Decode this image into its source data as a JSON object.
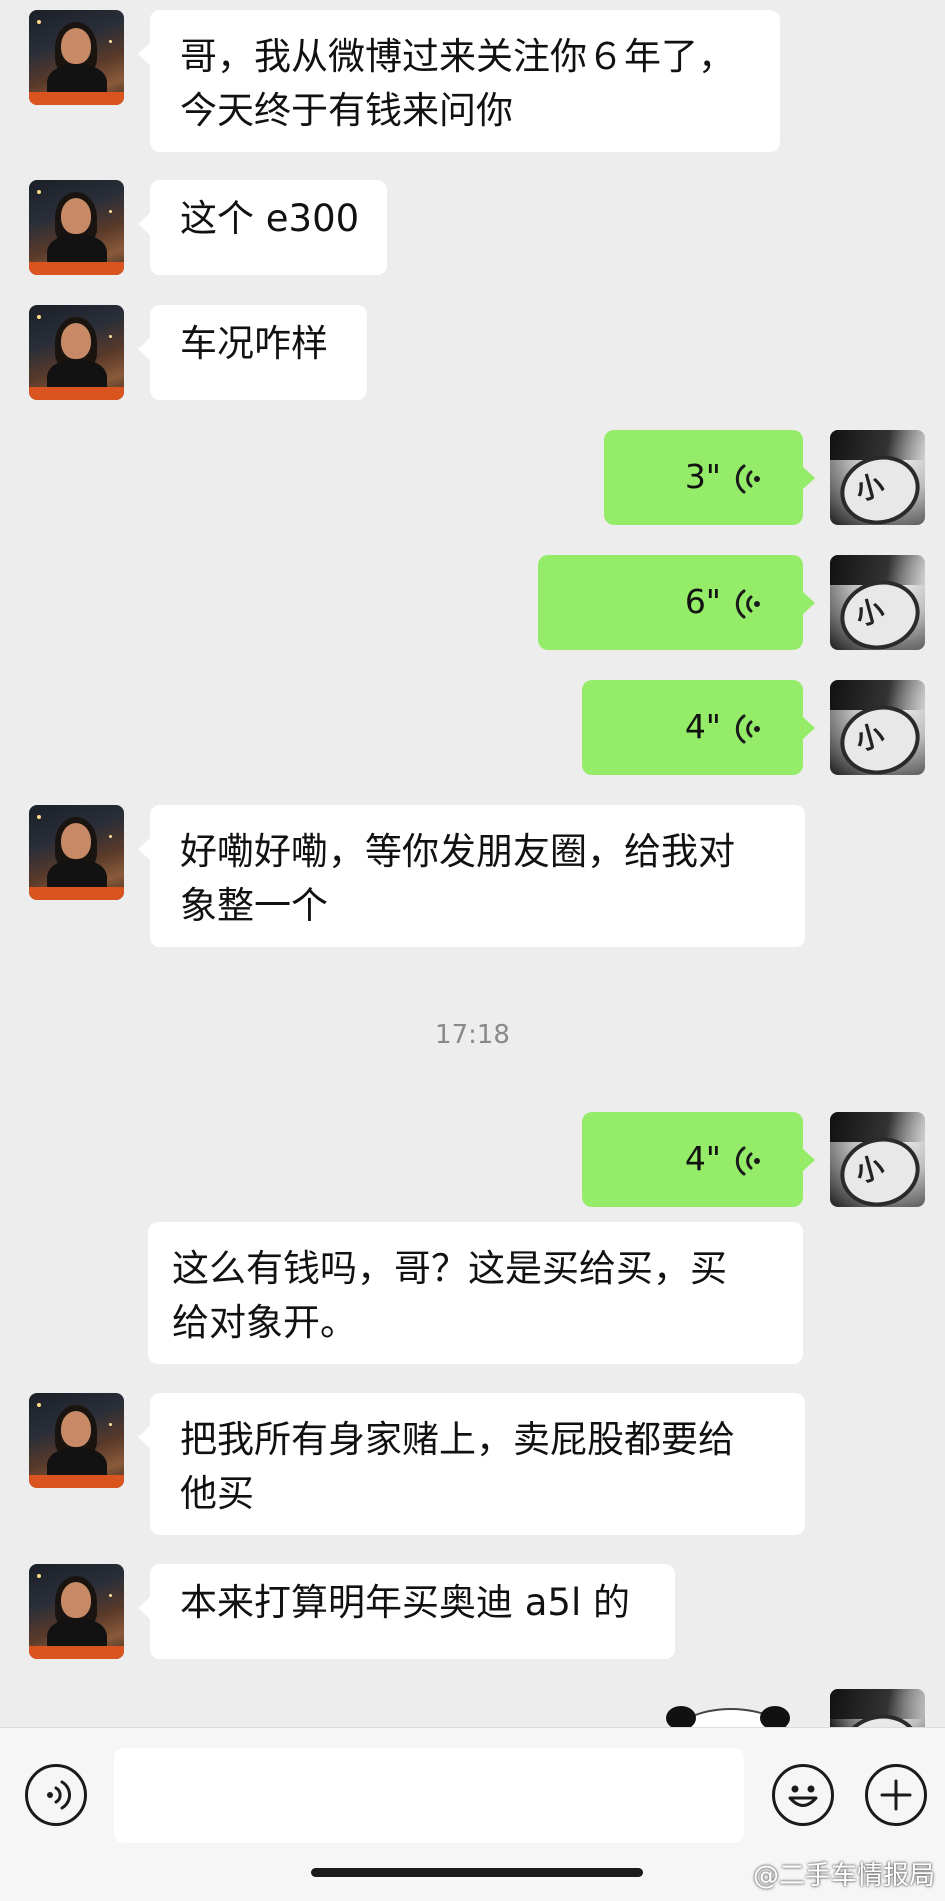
{
  "messages": [
    {
      "side": "left",
      "text_lines": [
        "哥，我从微博过来关注你６年了，",
        "今天终于有钱来问你"
      ]
    },
    {
      "side": "left",
      "text_lines": [
        "这个 e300"
      ]
    },
    {
      "side": "left",
      "text_lines": [
        "车况咋样"
      ]
    },
    {
      "side": "right",
      "type": "voice",
      "duration": "3\""
    },
    {
      "side": "right",
      "type": "voice",
      "duration": "6\""
    },
    {
      "side": "right",
      "type": "voice",
      "duration": "4\""
    },
    {
      "side": "left",
      "text_lines": [
        "好嘞好嘞，等你发朋友圈，给我对",
        "象整一个"
      ]
    },
    {
      "side": "right",
      "type": "voice",
      "duration": "4\""
    },
    {
      "side": "left",
      "text_lines": [
        "这么有钱吗，哥？这是买给买，买",
        "给对象开。"
      ]
    },
    {
      "side": "left",
      "text_lines": [
        "把我所有身家赌上，卖屁股都要给",
        "他买"
      ]
    },
    {
      "side": "left",
      "text_lines": [
        "本来打算明年买奥迪 a5l 的"
      ]
    }
  ],
  "timestamp": "17:18",
  "input_bar": {
    "voice_icon": "voice-mode-icon",
    "input_value": "",
    "emoji_icon": "emoji-icon",
    "plus_icon": "plus-icon"
  },
  "watermark": "@二手车情报局",
  "colors": {
    "background": "#ededed",
    "incoming_bubble": "#ffffff",
    "outgoing_bubble": "#95ec69",
    "timestamp_text": "#8a8a8a"
  }
}
